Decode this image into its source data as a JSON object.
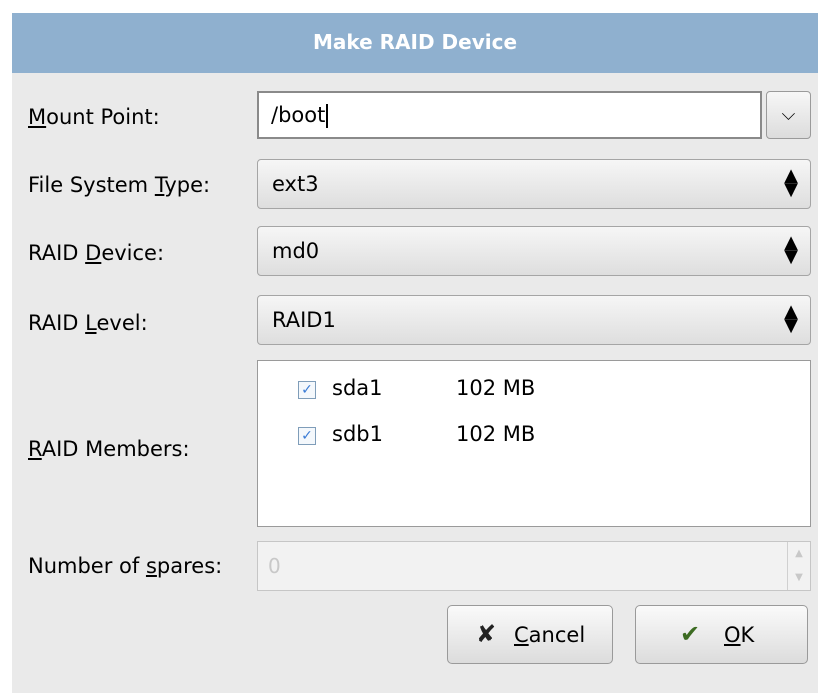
{
  "window": {
    "title": "Make RAID Device"
  },
  "labels": {
    "mount_point": {
      "u": "M",
      "rest": "ount Point:"
    },
    "fs_type": {
      "pre": "File System ",
      "u": "T",
      "post": "ype:"
    },
    "raid_device": {
      "pre": "RAID ",
      "u": "D",
      "post": "evice:"
    },
    "raid_level": {
      "pre": "RAID ",
      "u": "L",
      "post": "evel:"
    },
    "raid_members": {
      "u": "R",
      "rest": "AID Members:"
    },
    "spares": {
      "pre": "Number of ",
      "u": "s",
      "post": "pares:"
    }
  },
  "fields": {
    "mount_point": "/boot",
    "fs_type": "ext3",
    "raid_device": "md0",
    "raid_level": "RAID1",
    "spares": "0"
  },
  "members": [
    {
      "device": "sda1",
      "size": "102 MB",
      "checked": true
    },
    {
      "device": "sdb1",
      "size": "102 MB",
      "checked": true
    }
  ],
  "buttons": {
    "cancel": {
      "u": "C",
      "rest": "ancel"
    },
    "ok": {
      "u": "O",
      "rest": "K"
    }
  },
  "icons": {
    "dropdown": "chevron-down",
    "select_arrows": "up-down-arrows",
    "cancel": "x-mark",
    "ok": "checkmark-hand"
  },
  "colors": {
    "titlebar": "#8fb0cf",
    "dialog_bg": "#eaeaea"
  }
}
